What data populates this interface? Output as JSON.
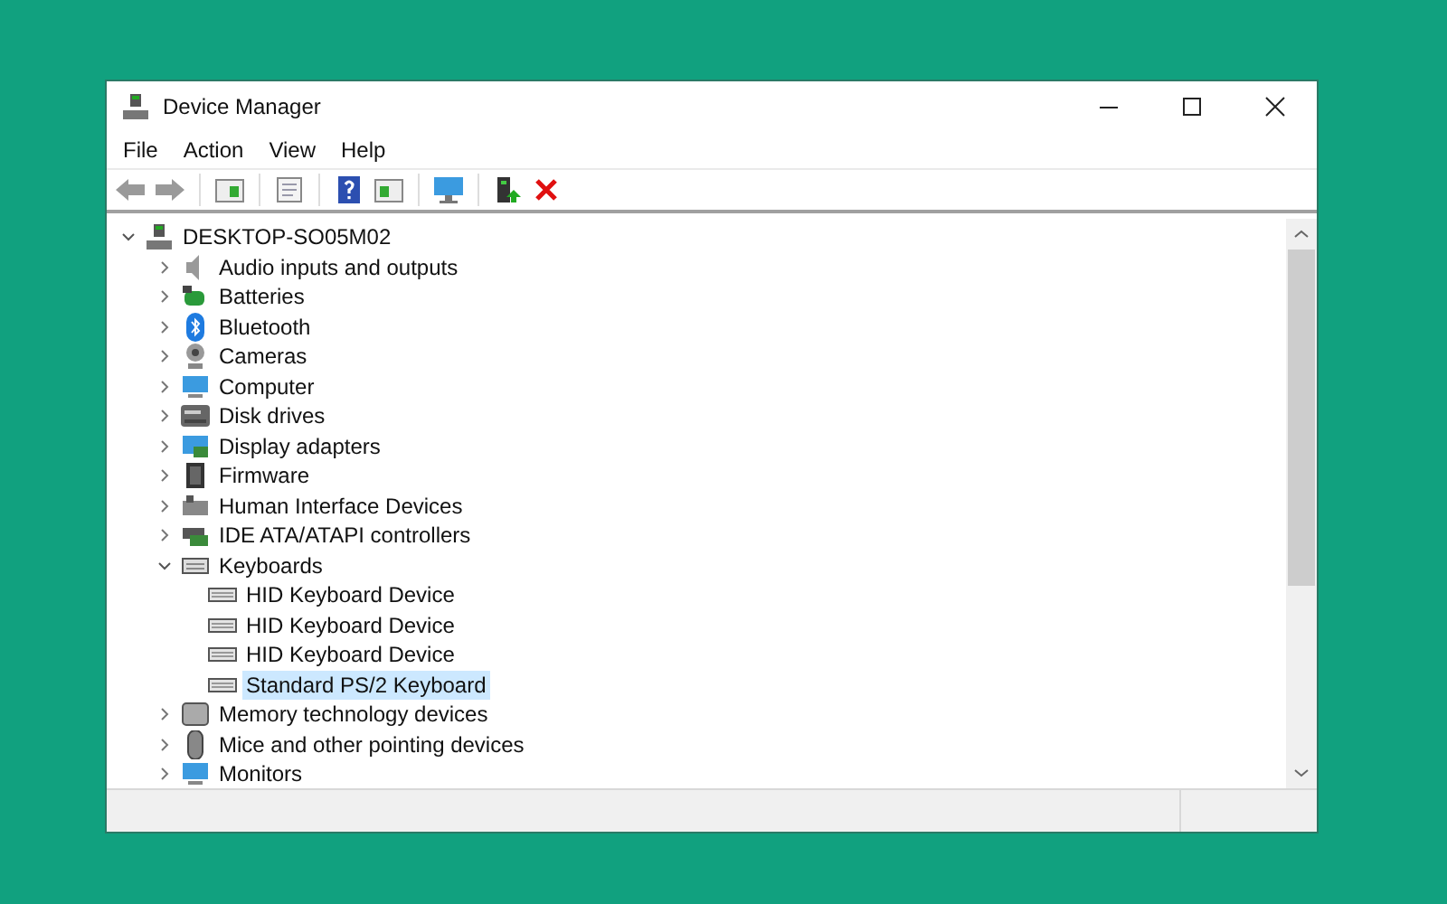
{
  "window": {
    "title": "Device Manager"
  },
  "menu": [
    "File",
    "Action",
    "View",
    "Help"
  ],
  "tree": {
    "label": "DESKTOP-SO05M02",
    "expanded": true,
    "children": [
      {
        "label": "Audio inputs and outputs",
        "expanded": false,
        "selected": false
      },
      {
        "label": "Batteries",
        "expanded": false,
        "selected": false
      },
      {
        "label": "Bluetooth",
        "expanded": false,
        "selected": false
      },
      {
        "label": "Cameras",
        "expanded": false,
        "selected": false
      },
      {
        "label": "Computer",
        "expanded": false,
        "selected": false
      },
      {
        "label": "Disk drives",
        "expanded": false,
        "selected": false
      },
      {
        "label": "Display adapters",
        "expanded": false,
        "selected": false
      },
      {
        "label": "Firmware",
        "expanded": false,
        "selected": false
      },
      {
        "label": "Human Interface Devices",
        "expanded": false,
        "selected": false
      },
      {
        "label": "IDE ATA/ATAPI controllers",
        "expanded": false,
        "selected": false
      },
      {
        "label": "Keyboards",
        "expanded": true,
        "selected": false,
        "children": [
          {
            "label": "HID Keyboard Device",
            "selected": false
          },
          {
            "label": "HID Keyboard Device",
            "selected": false
          },
          {
            "label": "HID Keyboard Device",
            "selected": false
          },
          {
            "label": "Standard PS/2 Keyboard",
            "selected": true
          }
        ]
      },
      {
        "label": "Memory technology devices",
        "expanded": false,
        "selected": false
      },
      {
        "label": "Mice and other pointing devices",
        "expanded": false,
        "selected": false
      },
      {
        "label": "Monitors",
        "expanded": false,
        "selected": false
      }
    ]
  }
}
